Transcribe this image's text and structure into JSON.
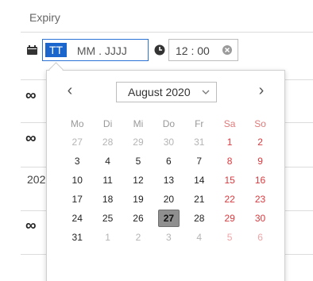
{
  "field_label": "Expiry",
  "date_input": {
    "day_segment": "TT",
    "rest": " MM . JJJJ"
  },
  "time_input": {
    "value": "12 : 00"
  },
  "background_rows": [
    {
      "type": "infinity",
      "symbol": "∞"
    },
    {
      "type": "infinity",
      "symbol": "∞"
    },
    {
      "type": "text",
      "value": "202"
    },
    {
      "type": "infinity",
      "symbol": "∞"
    }
  ],
  "calendar": {
    "month_label": "August 2020",
    "prev_symbol": "‹",
    "next_symbol": "›",
    "weekdays": [
      "Mo",
      "Di",
      "Mi",
      "Do",
      "Fr",
      "Sa",
      "So"
    ],
    "weeks": [
      [
        "27",
        "28",
        "29",
        "30",
        "31",
        "1",
        "2"
      ],
      [
        "3",
        "4",
        "5",
        "6",
        "7",
        "8",
        "9"
      ],
      [
        "10",
        "11",
        "12",
        "13",
        "14",
        "15",
        "16"
      ],
      [
        "17",
        "18",
        "19",
        "20",
        "21",
        "22",
        "23"
      ],
      [
        "24",
        "25",
        "26",
        "27",
        "28",
        "29",
        "30"
      ],
      [
        "31",
        "1",
        "2",
        "3",
        "4",
        "5",
        "6"
      ]
    ],
    "selected_day": "27"
  },
  "colors": {
    "accent": "#1a66cc",
    "weekend": "#d9393e",
    "today_bg": "#8f8f8f"
  },
  "icons": {
    "calendar": "calendar-icon",
    "clock": "clock-icon",
    "clear": "clear-icon",
    "chevron": "chevron-down-icon"
  }
}
